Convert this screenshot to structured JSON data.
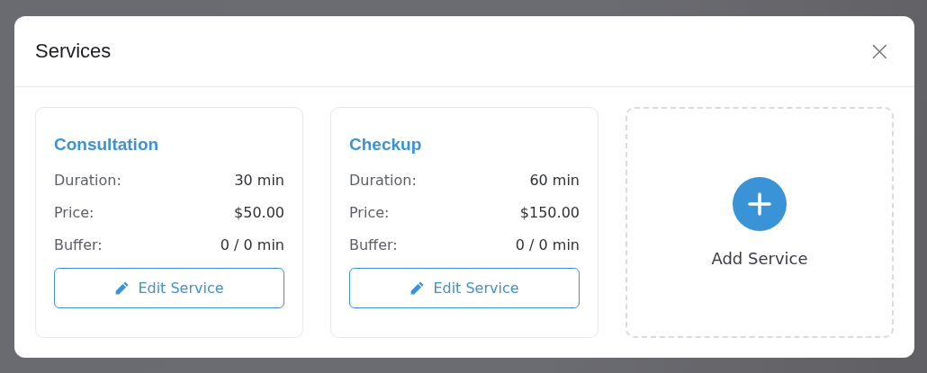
{
  "dialog": {
    "title": "Services",
    "close_label": "×"
  },
  "services": [
    {
      "name": "Consultation",
      "details": [
        {
          "label": "Duration:",
          "value": "30 min"
        },
        {
          "label": "Price:",
          "value": "$50.00"
        },
        {
          "label": "Buffer:",
          "value": "0 / 0 min"
        }
      ],
      "button": "Edit Service"
    },
    {
      "name": "Checkup",
      "details": [
        {
          "label": "Duration:",
          "value": "60 min"
        },
        {
          "label": "Price:",
          "value": "$150.00"
        },
        {
          "label": "Buffer:",
          "value": "0 / 0 min"
        }
      ],
      "button": "Edit Service"
    }
  ],
  "add_card": {
    "label": "Add Service"
  }
}
